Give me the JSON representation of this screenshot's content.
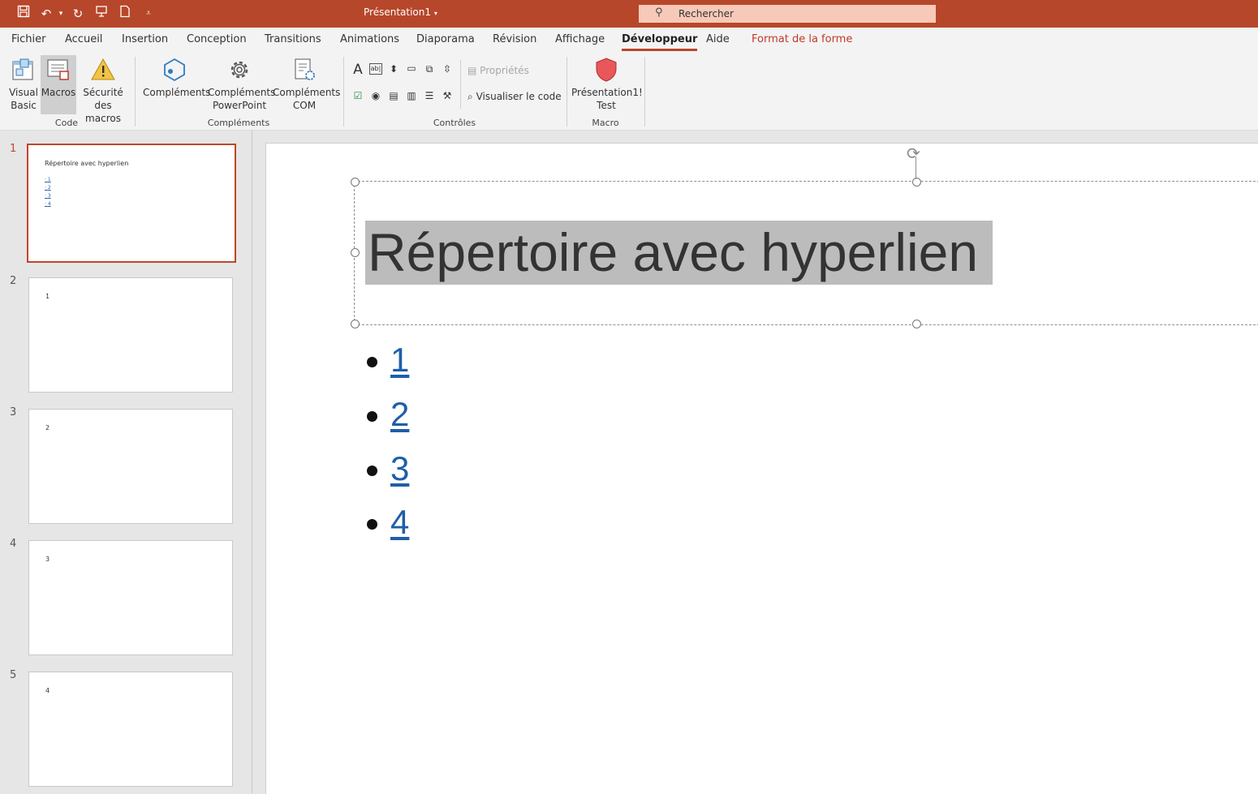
{
  "titlebar": {
    "doc_title": "Présentation1",
    "search_placeholder": "Rechercher",
    "colors": {
      "accent": "#b7472a"
    }
  },
  "menu": {
    "items": [
      "Fichier",
      "Accueil",
      "Insertion",
      "Conception",
      "Transitions",
      "Animations",
      "Diaporama",
      "Révision",
      "Affichage",
      "Développeur",
      "Aide",
      "Format de la forme"
    ],
    "active": "Développeur"
  },
  "ribbon": {
    "code": {
      "group_label": "Code",
      "visual_basic": {
        "l1": "Visual",
        "l2": "Basic"
      },
      "macros": "Macros",
      "security": {
        "l1": "Sécurité",
        "l2": "des macros"
      }
    },
    "complements": {
      "group_label": "Compléments",
      "addins": "Compléments",
      "ppt_addins": {
        "l1": "Compléments",
        "l2": "PowerPoint"
      },
      "com_addins": {
        "l1": "Compléments",
        "l2": "COM"
      }
    },
    "controls": {
      "group_label": "Contrôles",
      "properties": "Propriétés",
      "view_code": "Visualiser le code"
    },
    "macro": {
      "group_label": "Macro",
      "run": {
        "l1": "Présentation1!",
        "l2": "Test"
      }
    }
  },
  "slides": [
    {
      "num": "1",
      "title": "Répertoire avec hyperlien",
      "bullets": [
        "1",
        "2",
        "3",
        "4"
      ]
    },
    {
      "num": "2",
      "title": "1"
    },
    {
      "num": "3",
      "title": "2"
    },
    {
      "num": "4",
      "title": "3"
    },
    {
      "num": "5",
      "title": "4"
    }
  ],
  "editor": {
    "title": "Répertoire avec hyperlien",
    "bullets": [
      "1",
      "2",
      "3",
      "4"
    ]
  }
}
